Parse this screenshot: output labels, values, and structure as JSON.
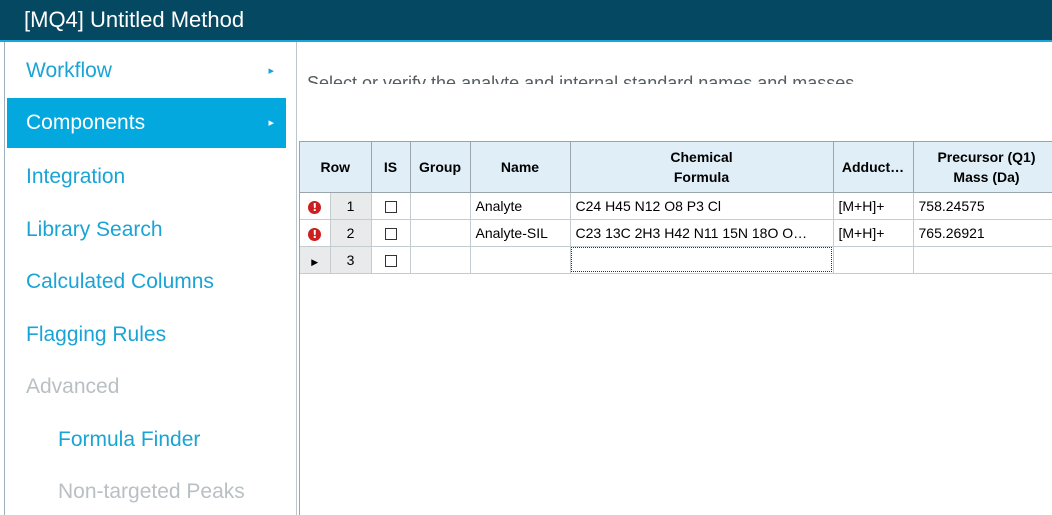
{
  "window": {
    "title": "[MQ4] Untitled Method"
  },
  "sidebar": {
    "items": [
      {
        "label": "Workflow",
        "arrow": "▸"
      },
      {
        "label": "Components",
        "arrow": "▸"
      },
      {
        "label": "Integration"
      },
      {
        "label": "Library Search"
      },
      {
        "label": "Calculated Columns"
      },
      {
        "label": "Flagging Rules"
      },
      {
        "label": "Advanced"
      },
      {
        "label": "Formula Finder"
      },
      {
        "label": "Non-targeted Peaks"
      }
    ],
    "selected": "Components",
    "accent_color": "#03a8df"
  },
  "main": {
    "instruction": "Select or verify the analyte and internal standard names and masses"
  },
  "grid": {
    "columns": [
      "Row",
      "IS",
      "Group",
      "Name",
      "Chemical Formula",
      "Adduct/Charge",
      "Precursor (Q1) Mass (Da)"
    ],
    "columns_display": {
      "row": "Row",
      "is": "IS",
      "group": "Group",
      "name": "Name",
      "formula_line1": "Chemical",
      "formula_line2": "Formula",
      "adduct": "Adduct…",
      "precursor_line1": "Precursor (Q1)",
      "precursor_line2": "Mass (Da)"
    },
    "rows": [
      {
        "indicator": "error-icon",
        "row": "1",
        "is": false,
        "group": "",
        "name": "Analyte",
        "formula": "C24 H45 N12 O8 P3 Cl",
        "adduct": "[M+H]+",
        "precursor": "758.24575"
      },
      {
        "indicator": "error-icon",
        "row": "2",
        "is": false,
        "group": "",
        "name": "Analyte-SIL",
        "formula": "C23 13C 2H3 H42 N11 15N 18O O…",
        "adduct": "[M+H]+",
        "precursor": "765.26921"
      },
      {
        "indicator": "current-row-icon",
        "row": "3",
        "is": false,
        "group": "",
        "name": "",
        "formula": "",
        "adduct": "",
        "precursor": ""
      }
    ],
    "error_glyph": "!",
    "current_glyph": "▶"
  }
}
